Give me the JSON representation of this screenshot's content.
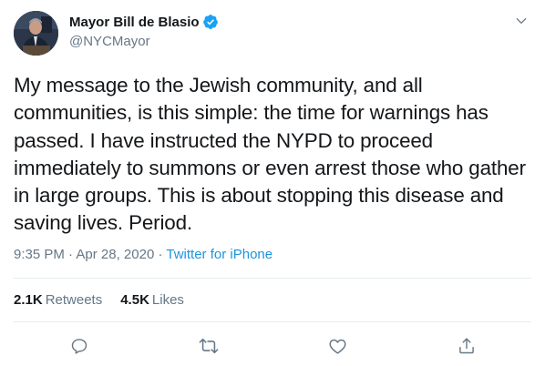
{
  "author": {
    "display_name": "Mayor Bill de Blasio",
    "handle": "@NYCMayor",
    "verified": true
  },
  "tweet": {
    "text": "My message to the Jewish community, and all communities, is this simple: the time for warnings has passed. I have instructed the NYPD to proceed immediately to summons or even arrest those who gather in large groups. This is about stopping this disease and saving lives. Period.",
    "time": "9:35 PM",
    "separator": "·",
    "date": "Apr 28, 2020",
    "source": "Twitter for iPhone"
  },
  "stats": {
    "retweets_count": "2.1K",
    "retweets_label": "Retweets",
    "likes_count": "4.5K",
    "likes_label": "Likes"
  },
  "icons": {
    "caret": "chevron-down-icon",
    "verified": "verified-badge-icon",
    "reply": "reply-icon",
    "retweet": "retweet-icon",
    "like": "heart-icon",
    "share": "share-icon"
  },
  "colors": {
    "text_primary": "#14171a",
    "text_secondary": "#657786",
    "link": "#1b95e0",
    "verified": "#1da1f2",
    "divider": "#e6ecf0"
  }
}
